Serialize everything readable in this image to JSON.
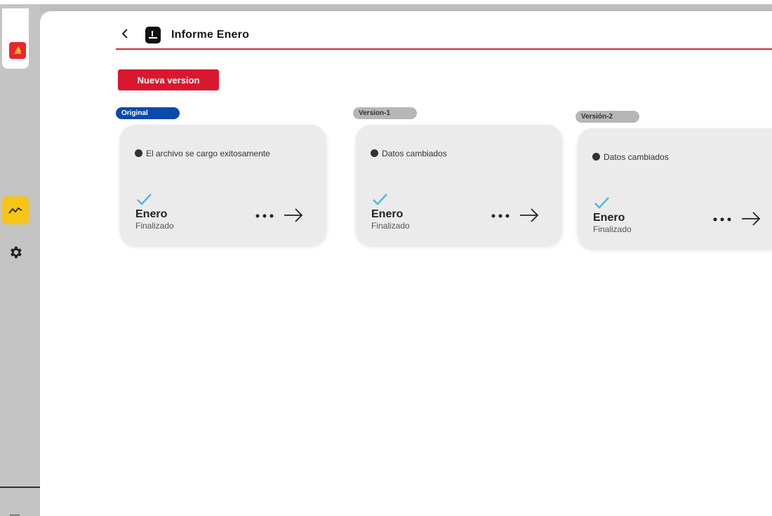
{
  "header": {
    "title": "Informe Enero",
    "back_icon": "chevron-left-icon",
    "doc_icon": "document-icon"
  },
  "actions": {
    "new_version_label": "Nueva version"
  },
  "sidebar": {
    "logo_icon": "app-logo-icon",
    "items": [
      {
        "icon": "trend-chart-icon",
        "active": true
      },
      {
        "icon": "gear-icon",
        "active": false
      }
    ]
  },
  "versions": [
    {
      "tag": "Original",
      "tag_style": "blue",
      "description": "El archivo se cargo exitosamente",
      "month": "Enero",
      "status": "Finalizado"
    },
    {
      "tag": "Version-1",
      "tag_style": "grey",
      "description": "Datos cambiados",
      "month": "Enero",
      "status": "Finalizado"
    },
    {
      "tag": "Versión-2",
      "tag_style": "grey",
      "description": "Datos cambiados",
      "month": "Enero",
      "status": "Finalizado"
    }
  ],
  "colors": {
    "accent_red": "#d9182f",
    "tag_blue": "#0a4aa8",
    "tag_grey": "#b6b6b6",
    "active_nav": "#f5c518",
    "check": "#4db6e0"
  }
}
